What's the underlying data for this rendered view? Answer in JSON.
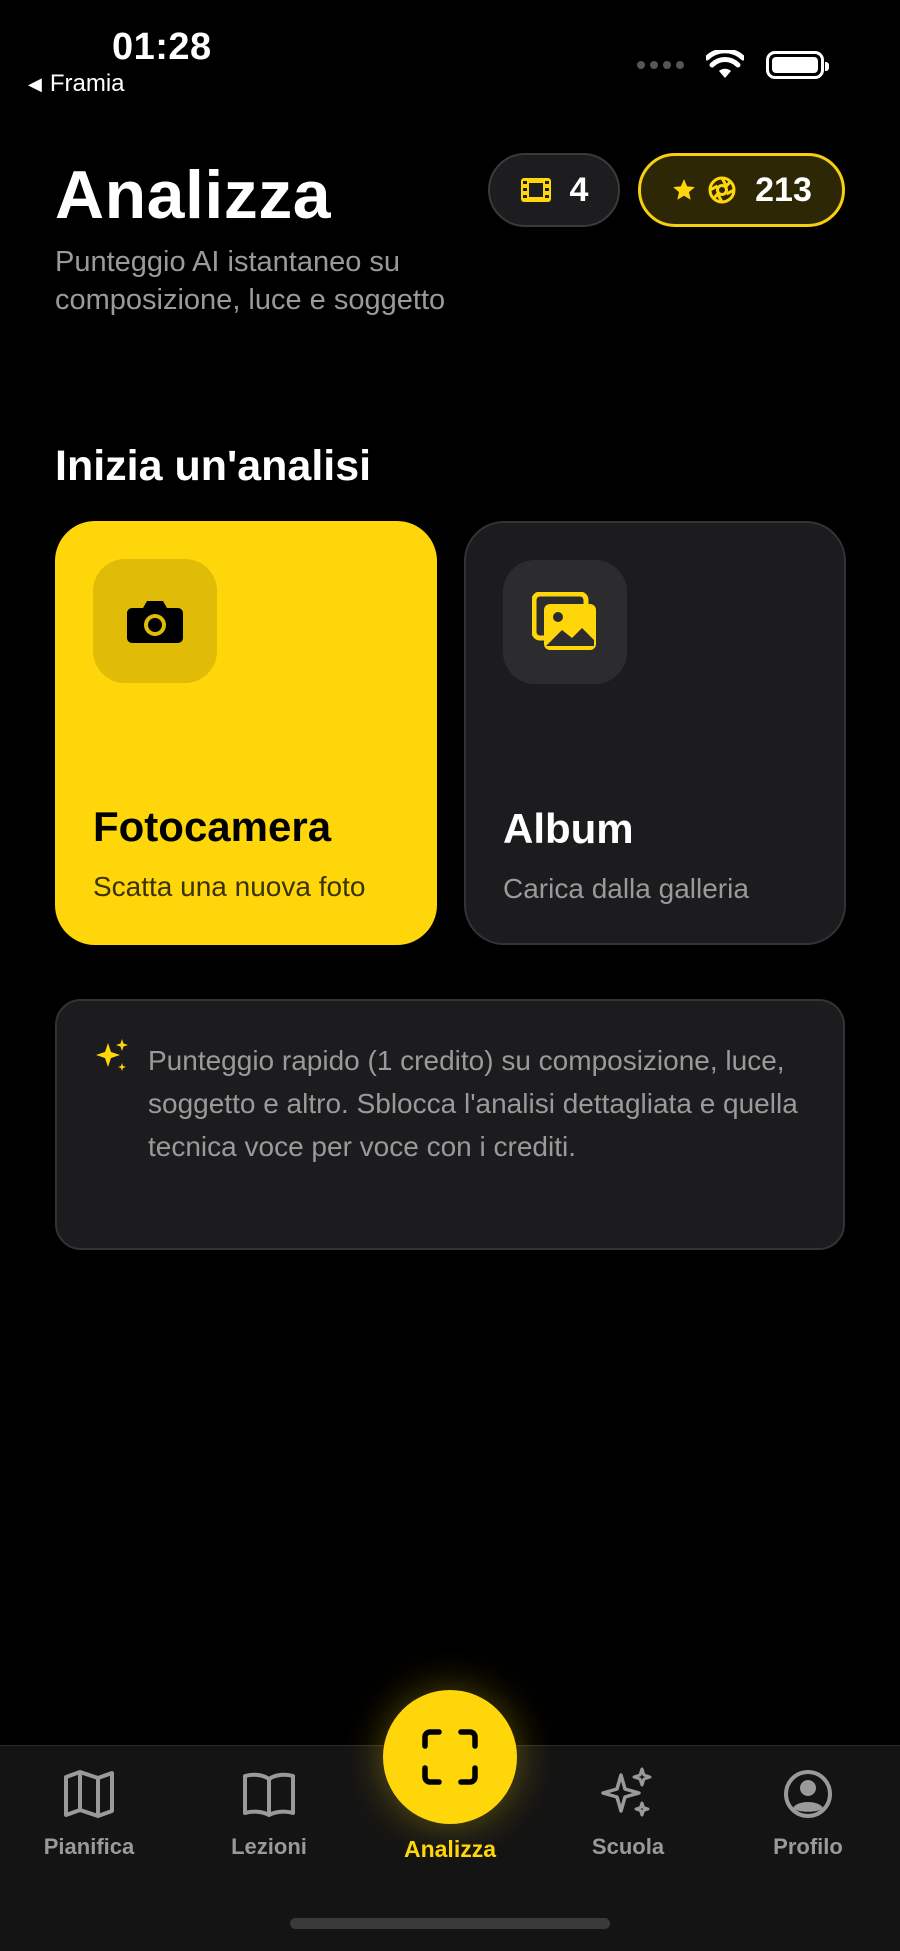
{
  "status_bar": {
    "time": "01:28",
    "back_app": "Framia",
    "icons": [
      "signal-icon",
      "wifi-icon",
      "battery-icon"
    ]
  },
  "header": {
    "title": "Analizza",
    "subtitle": "Punteggio AI istantaneo su composizione, luce e soggetto",
    "film_count": "4",
    "credits": "213",
    "film_icon": "film-icon",
    "star_icon": "star-icon",
    "aperture_icon": "aperture-icon"
  },
  "section": {
    "title": "Inizia un'analisi"
  },
  "cards": {
    "camera": {
      "title": "Fotocamera",
      "subtitle": "Scatta una nuova foto",
      "icon": "camera-icon"
    },
    "album": {
      "title": "Album",
      "subtitle": "Carica dalla galleria",
      "icon": "photos-icon"
    }
  },
  "info": {
    "text": "Punteggio rapido (1 credito) su composizione, luce, soggetto e altro. Sblocca l'analisi dettagliata e quella tecnica voce per voce con i crediti.",
    "icon": "sparkles-icon"
  },
  "tabbar": {
    "tabs": [
      {
        "label": "Pianifica",
        "icon": "map-icon"
      },
      {
        "label": "Lezioni",
        "icon": "book-icon"
      },
      {
        "label": "Analizza",
        "icon": "scan-icon",
        "active": true
      },
      {
        "label": "Scuola",
        "icon": "sparkles-icon"
      },
      {
        "label": "Profilo",
        "icon": "profile-icon"
      }
    ]
  },
  "colors": {
    "accent": "#ffd60a",
    "background": "#000000",
    "card": "#1c1c1e",
    "muted_text": "#9a9a9a"
  }
}
